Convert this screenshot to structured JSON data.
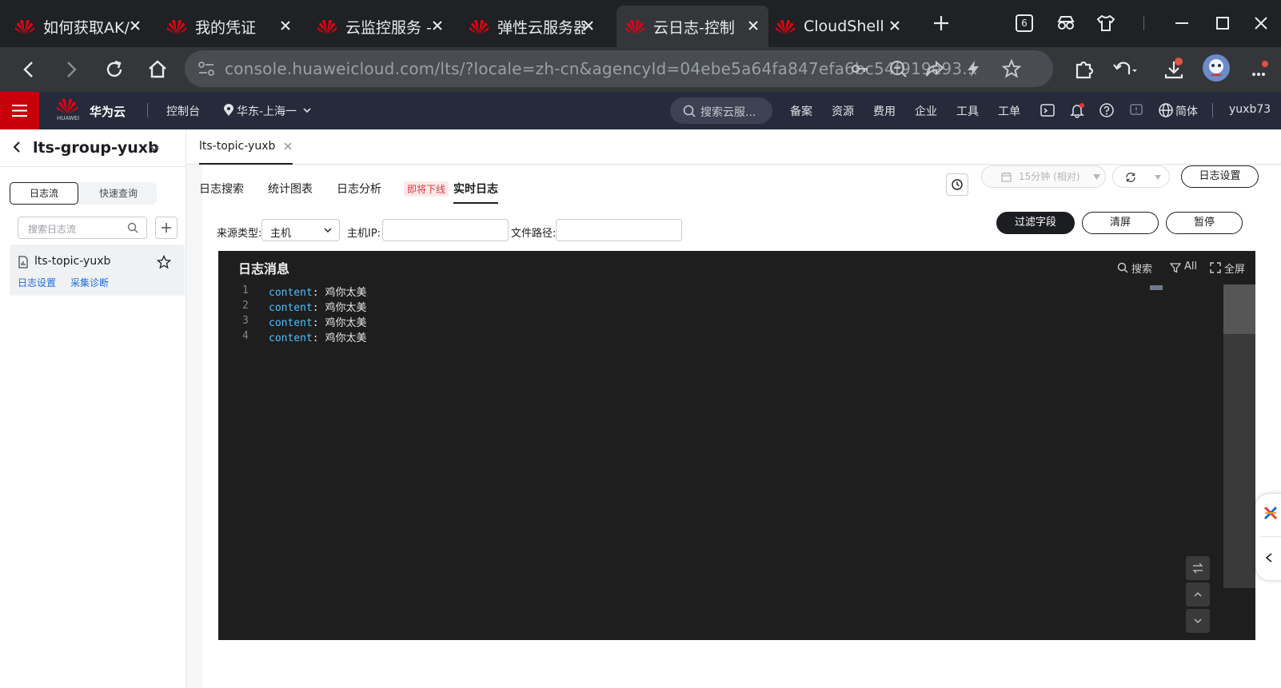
{
  "browser": {
    "tabs": [
      {
        "title": "如何获取AK/"
      },
      {
        "title": "我的凭证"
      },
      {
        "title": "云监控服务 -"
      },
      {
        "title": "弹性云服务器"
      },
      {
        "title": "云日志-控制"
      },
      {
        "title": "CloudShell"
      }
    ],
    "tab_count_badge": "6",
    "address_url": "console.huaweicloud.com/lts/?locale=zh-cn&agencyId=04ebe5a64fa847efa6bc54f919e93..."
  },
  "console": {
    "brand": "华为云",
    "logo_caption": "HUAWEI",
    "console_label": "控制台",
    "region": "华东-上海一",
    "search_placeholder": "搜索云服...",
    "nav": [
      "备案",
      "资源",
      "费用",
      "企业",
      "工具",
      "工单"
    ],
    "language": "简体",
    "user": "yuxb73"
  },
  "sidebar": {
    "group_name": "lts-group-yuxb",
    "seg_log_stream": "日志流",
    "seg_quick_query": "快速查询",
    "search_placeholder": "搜索日志流",
    "stream_name": "lts-topic-yuxb",
    "stream_settings": "日志设置",
    "stream_diagnosis": "采集诊断"
  },
  "main": {
    "page_tab": "lts-topic-yuxb",
    "tabs": [
      "日志搜索",
      "统计图表",
      "日志分析",
      "实时日志"
    ],
    "deprecated_badge": "即将下线",
    "time_range": "15分钟 (相对)",
    "log_settings": "日志设置",
    "filters": {
      "source_type_label": "来源类型:",
      "source_type_value": "主机",
      "host_ip_label": "主机IP:",
      "file_path_label": "文件路径:"
    },
    "buttons": {
      "filter_fields": "过滤字段",
      "clear_screen": "清屏",
      "pause": "暂停"
    },
    "log_panel": {
      "title": "日志消息",
      "search": "搜索",
      "all": "All",
      "fullscreen": "全屏",
      "lines": [
        {
          "no": "1",
          "key": "content",
          "value": "鸡你太美"
        },
        {
          "no": "2",
          "key": "content",
          "value": "鸡你太美"
        },
        {
          "no": "3",
          "key": "content",
          "value": "鸡你太美"
        },
        {
          "no": "4",
          "key": "content",
          "value": "鸡你太美"
        }
      ]
    }
  }
}
